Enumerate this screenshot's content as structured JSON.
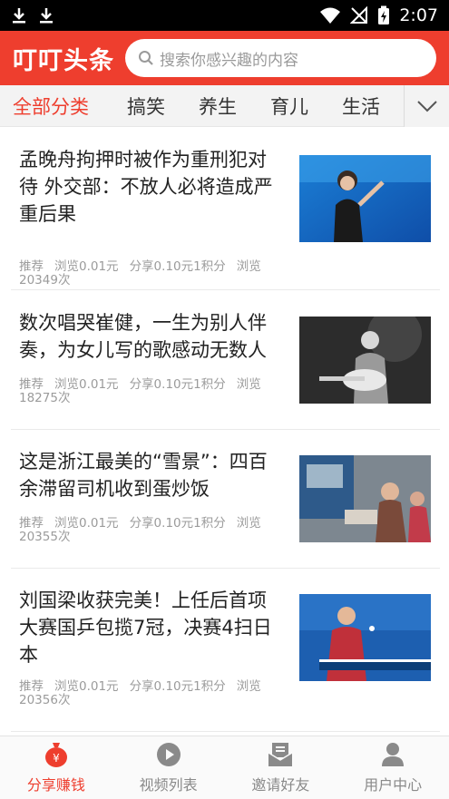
{
  "status_bar": {
    "time": "2:07"
  },
  "header": {
    "app_title": "叮叮头条",
    "search_placeholder": "搜索你感兴趣的内容"
  },
  "tabs": [
    {
      "label": "全部分类",
      "active": true
    },
    {
      "label": "搞笑",
      "active": false
    },
    {
      "label": "养生",
      "active": false
    },
    {
      "label": "育儿",
      "active": false
    },
    {
      "label": "生活",
      "active": false
    }
  ],
  "articles": [
    {
      "title": "孟晚舟拘押时被作为重刑犯对待 外交部：不放人必将造成严重后果",
      "tag": "推荐",
      "browse": "浏览0.01元",
      "share": "分享0.10元1积分",
      "views": "浏览20349次"
    },
    {
      "title": "数次唱哭崔健，一生为别人伴奏，为女儿写的歌感动无数人",
      "tag": "推荐",
      "browse": "浏览0.01元",
      "share": "分享0.10元1积分",
      "views": "浏览18275次"
    },
    {
      "title": "这是浙江最美的“雪景”：四百余滞留司机收到蛋炒饭",
      "tag": "推荐",
      "browse": "浏览0.01元",
      "share": "分享0.10元1积分",
      "views": "浏览20355次"
    },
    {
      "title": "刘国梁收获完美！上任后首项大赛国乒包揽7冠，决赛4扫日本",
      "tag": "推荐",
      "browse": "浏览0.01元",
      "share": "分享0.10元1积分",
      "views": "浏览20356次"
    }
  ],
  "bottom_nav": [
    {
      "label": "分享赚钱",
      "icon": "money-bag-icon",
      "active": true
    },
    {
      "label": "视频列表",
      "icon": "play-icon",
      "active": false
    },
    {
      "label": "邀请好友",
      "icon": "mail-icon",
      "active": false
    },
    {
      "label": "用户中心",
      "icon": "user-icon",
      "active": false
    }
  ],
  "colors": {
    "accent": "#ee3e2e",
    "inactive": "#8a8a8a"
  }
}
